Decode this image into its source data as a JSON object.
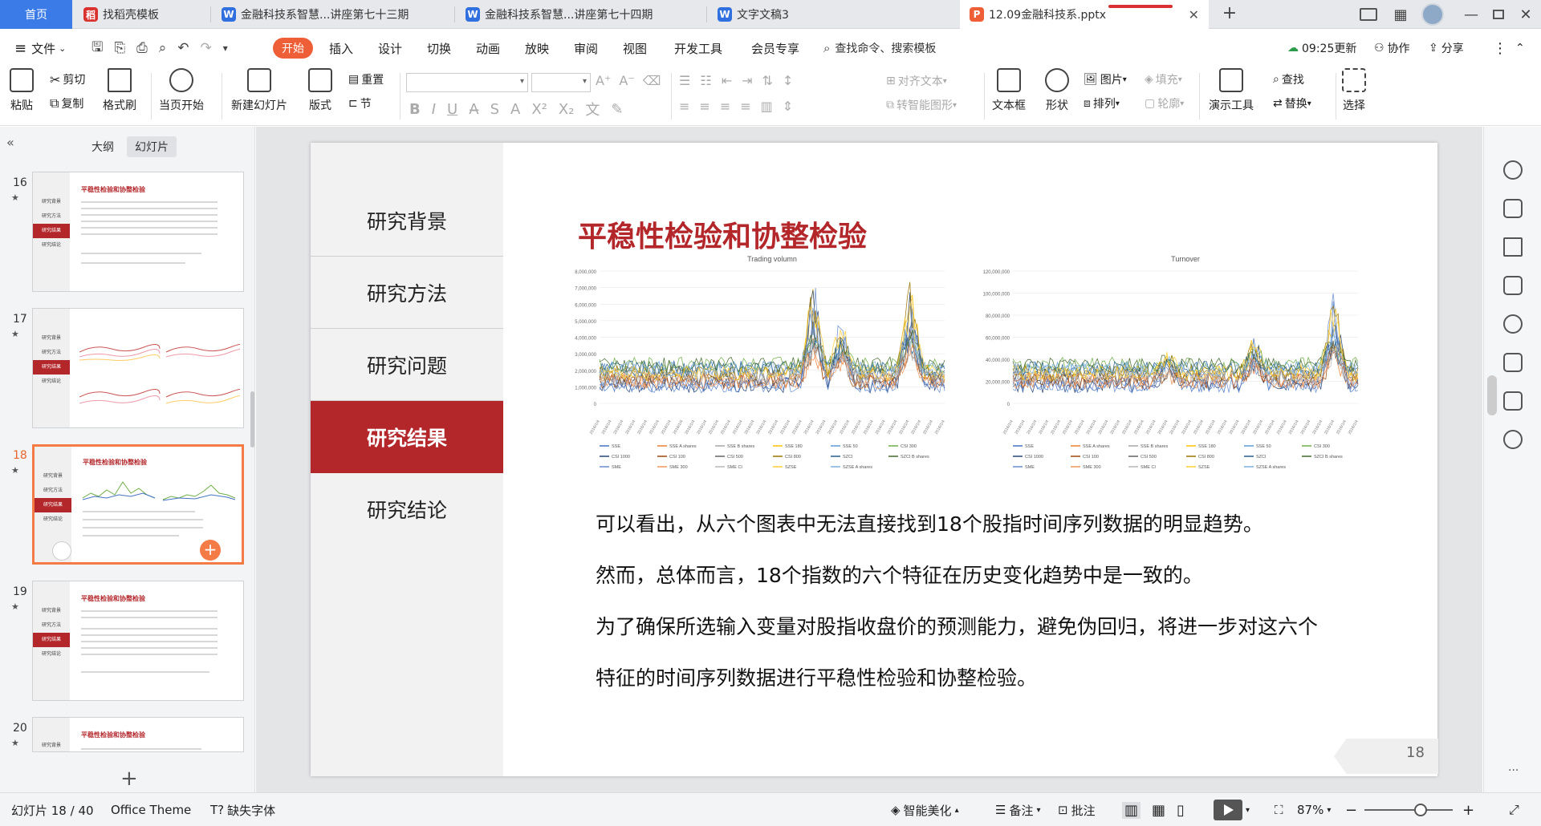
{
  "tabs": {
    "home": "首页",
    "items": [
      {
        "label": "找稻壳模板",
        "icon": "daoke-icon",
        "color": "#d9312d"
      },
      {
        "label": "金融科技系智慧...讲座第七十三期",
        "icon": "wps-writer-icon",
        "color": "#2f6fdf"
      },
      {
        "label": "金融科技系智慧...讲座第七十四期",
        "icon": "wps-writer-icon",
        "color": "#2f6fdf"
      },
      {
        "label": "文字文稿3",
        "icon": "wps-writer-icon",
        "color": "#2f6fdf"
      },
      {
        "label": "12.09金融科技系.pptx",
        "icon": "wps-presentation-icon",
        "color": "#ee5f37"
      }
    ]
  },
  "menu": {
    "file": "文件",
    "items": [
      "开始",
      "插入",
      "设计",
      "切换",
      "动画",
      "放映",
      "审阅",
      "视图",
      "开发工具",
      "会员专享"
    ],
    "search": "查找命令、搜索模板",
    "sync_time": "09:25更新",
    "collab": "协作",
    "share": "分享"
  },
  "ribbon": {
    "paste": "粘贴",
    "cut": "剪切",
    "copy": "复制",
    "format_painter": "格式刷",
    "from_current": "当页开始",
    "new_slide": "新建幻灯片",
    "layout": "版式",
    "reset": "重置",
    "section": "节",
    "align_text": "对齐文本",
    "smart_graphic": "转智能图形",
    "textbox": "文本框",
    "shape": "形状",
    "picture": "图片",
    "arrange": "排列",
    "fill": "填充",
    "outline": "轮廓",
    "present_tools": "演示工具",
    "find": "查找",
    "replace": "替换",
    "select": "选择"
  },
  "left_panel": {
    "tab_outline": "大纲",
    "tab_slides": "幻灯片",
    "thumbs": [
      {
        "num": "16",
        "title": "平稳性检验和协整检验"
      },
      {
        "num": "17",
        "title": ""
      },
      {
        "num": "18",
        "title": "平稳性检验和协整检验"
      },
      {
        "num": "19",
        "title": "平稳性检验和协整检验"
      },
      {
        "num": "20",
        "title": "平稳性检验和协整检验"
      }
    ],
    "nav_mini": [
      "研究背景",
      "研究方法",
      "研究结果",
      "研究结论"
    ]
  },
  "slide": {
    "nav": [
      "研究背景",
      "研究方法",
      "研究问题",
      "研究结果",
      "研究结论"
    ],
    "active_nav": 3,
    "title": "平稳性检验和协整检验",
    "paragraphs": [
      "可以看出，从六个图表中无法直接找到18个股指时间序列数据的明显趋势。",
      "然而，总体而言，18个指数的六个特征在历史变化趋势中是一致的。",
      "为了确保所选输入变量对股指收盘价的预测能力，避免伪回归，将进一步对这六个",
      "特征的时间序列数据进行平稳性检验和协整检验。"
    ],
    "page_number": "18"
  },
  "chart_data": [
    {
      "type": "line",
      "title": "Trading volumn",
      "ylim": [
        0,
        8000000
      ],
      "y_ticks": [
        "0",
        "1,000,000",
        "2,000,000",
        "3,000,000",
        "4,000,000",
        "5,000,000",
        "6,000,000",
        "7,000,000",
        "8,000,000"
      ],
      "x_tick_count": 30,
      "x_start": "2016/1/4",
      "series_names": [
        "SSE",
        "SSE A shares",
        "SSE B shares",
        "SSE 180",
        "SSE 50",
        "CSI 300",
        "CSI 1000",
        "CSI 100",
        "CSI 500",
        "CSI 800",
        "SZCI",
        "SZCI B shares",
        "SME",
        "SME 300",
        "SME CI",
        "SZSE",
        "SZSE A shares"
      ],
      "series_colors": [
        "#4472c4",
        "#ed7d31",
        "#a5a5a5",
        "#ffc000",
        "#5b9bd5",
        "#70ad47",
        "#264478",
        "#9e480e",
        "#636363",
        "#997300",
        "#255e91",
        "#43682b",
        "#698ed0",
        "#f1975a",
        "#b7b7b7",
        "#ffcd33",
        "#7cafdd"
      ],
      "shape": "noisy band around 1,000,000–2,500,000 with spikes up to ~7,500,000 near 2019 and 2020"
    },
    {
      "type": "line",
      "title": "Turnover",
      "ylim": [
        0,
        120000000
      ],
      "y_ticks": [
        "0",
        "20,000,000",
        "40,000,000",
        "60,000,000",
        "80,000,000",
        "100,000,000",
        "120,000,000"
      ],
      "x_tick_count": 30,
      "x_start": "2016/1/4",
      "series_names": [
        "SSE",
        "SSE A shares",
        "SSE B shares",
        "SSE 180",
        "SSE 50",
        "CSI 300",
        "CSI 1000",
        "CSI 100",
        "CSI 500",
        "CSI 800",
        "SZCI",
        "SZCI B shares",
        "SME",
        "SME 300",
        "SME CI",
        "SZSE",
        "SZSE A shares"
      ],
      "series_colors": [
        "#4472c4",
        "#ed7d31",
        "#a5a5a5",
        "#ffc000",
        "#5b9bd5",
        "#70ad47",
        "#264478",
        "#9e480e",
        "#636363",
        "#997300",
        "#255e91",
        "#43682b",
        "#698ed0",
        "#f1975a",
        "#b7b7b7",
        "#ffcd33",
        "#7cafdd"
      ],
      "shape": "noisy band around 10,000,000–35,000,000 with spikes up to ~100,000,000 near 2020"
    }
  ],
  "status": {
    "slide_counter": "幻灯片 18 / 40",
    "theme": "Office Theme",
    "missing_font": "缺失字体",
    "beautify": "智能美化",
    "notes": "备注",
    "comments": "批注",
    "zoom": "87%"
  },
  "colors": {
    "accent": "#b3272b",
    "start_button": "#ee5f37",
    "home_tab": "#3b7be8"
  }
}
